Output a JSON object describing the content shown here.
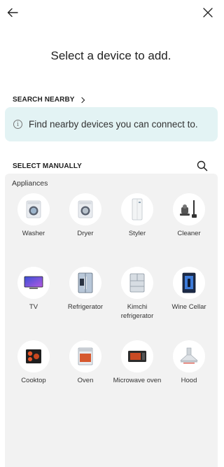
{
  "header": {
    "back_icon": "arrow-left-icon",
    "close_icon": "close-icon"
  },
  "title": "Select a device to add.",
  "search_nearby": {
    "label": "SEARCH NEARBY",
    "banner_text": "Find nearby devices you can connect to.",
    "banner_icon": "info-icon",
    "banner_color": "#e3f3f4"
  },
  "select_manually": {
    "label": "SELECT MANUALLY",
    "search_icon": "search-icon"
  },
  "appliances": {
    "heading": "Appliances",
    "items": [
      {
        "label": "Washer",
        "icon": "washer-icon"
      },
      {
        "label": "Dryer",
        "icon": "dryer-icon"
      },
      {
        "label": "Styler",
        "icon": "styler-icon"
      },
      {
        "label": "Cleaner",
        "icon": "cleaner-icon"
      },
      {
        "label": "TV",
        "icon": "tv-icon"
      },
      {
        "label": "Refrigerator",
        "icon": "refrigerator-icon"
      },
      {
        "label": "Kimchi\nrefrigerator",
        "icon": "kimchi-refrigerator-icon"
      },
      {
        "label": "Wine Cellar",
        "icon": "wine-cellar-icon"
      },
      {
        "label": "Cooktop",
        "icon": "cooktop-icon"
      },
      {
        "label": "Oven",
        "icon": "oven-icon"
      },
      {
        "label": "Microwave oven",
        "icon": "microwave-oven-icon"
      },
      {
        "label": "Hood",
        "icon": "hood-icon"
      }
    ]
  }
}
